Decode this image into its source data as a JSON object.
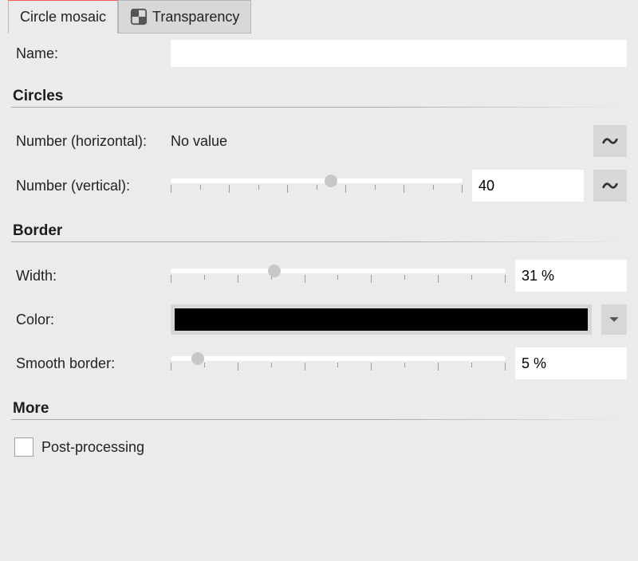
{
  "tabs": {
    "circle_mosaic": "Circle mosaic",
    "transparency": "Transparency"
  },
  "name": {
    "label": "Name:",
    "value": ""
  },
  "sections": {
    "circles": "Circles",
    "border": "Border",
    "more": "More"
  },
  "circles": {
    "num_h": {
      "label": "Number (horizontal):",
      "value_text": "No value"
    },
    "num_v": {
      "label": "Number (vertical):",
      "value": "40",
      "slider_pct": 55
    }
  },
  "border": {
    "width": {
      "label": "Width:",
      "value": "31 %",
      "slider_pct": 31
    },
    "color": {
      "label": "Color:",
      "hex": "#000000"
    },
    "smooth": {
      "label": "Smooth border:",
      "value": "5 %",
      "slider_pct": 8
    }
  },
  "more": {
    "post_processing": {
      "label": "Post-processing",
      "checked": false
    }
  }
}
